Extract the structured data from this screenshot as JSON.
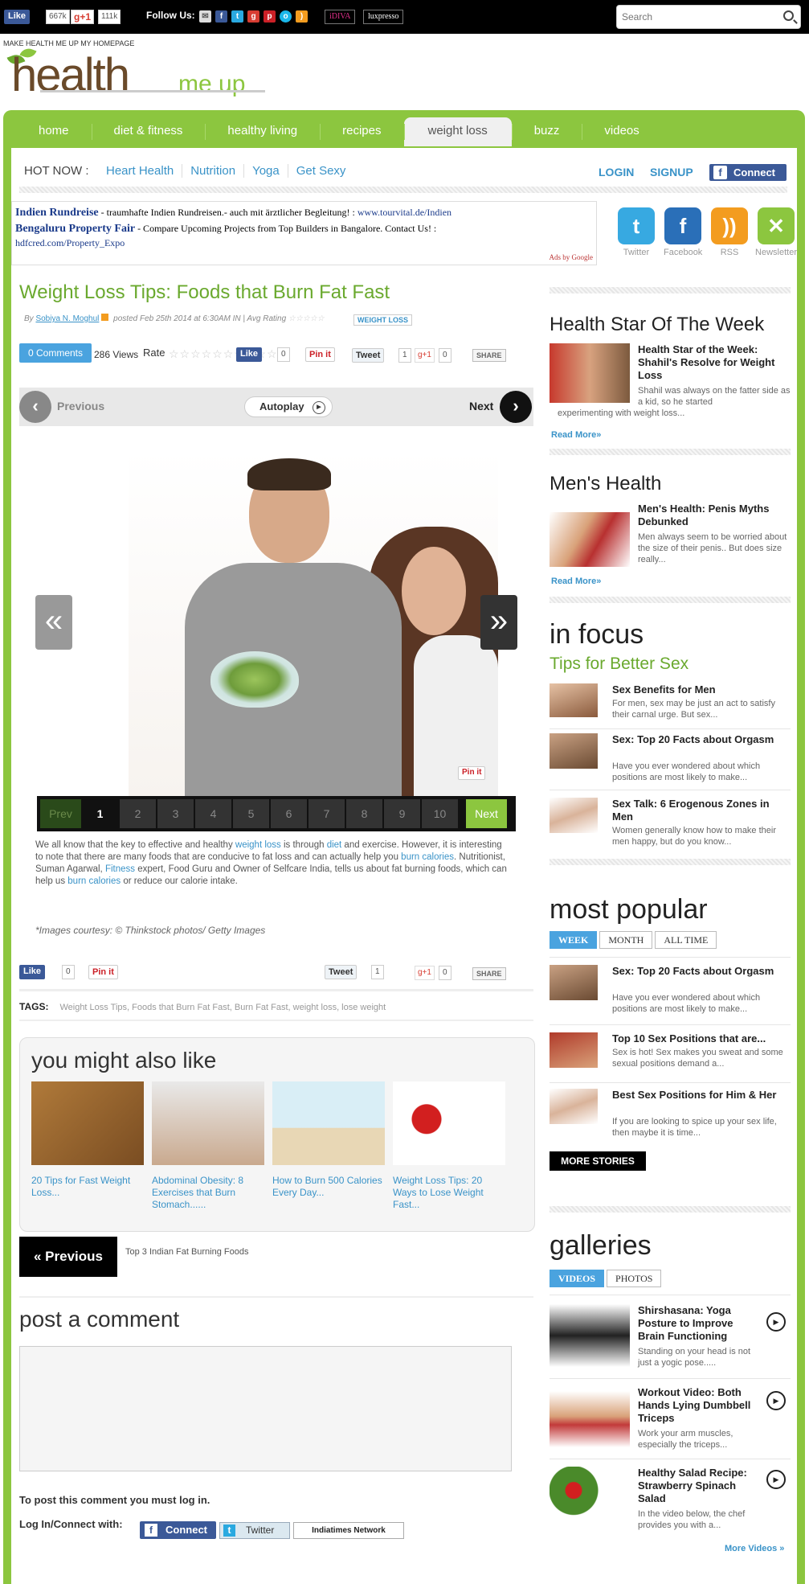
{
  "topbar": {
    "fb_like": "Like",
    "fb_count": "667k",
    "gplus": "g+1",
    "gplus_count": "111k",
    "follow_us": "Follow Us:",
    "brands": [
      "iDIVA",
      "luxpresso"
    ],
    "search_placeholder": "Search"
  },
  "header": {
    "make_homepage": "MAKE HEALTH ME UP MY HOMEPAGE",
    "logo_main": "health",
    "logo_sub": "me up"
  },
  "nav": {
    "items": [
      "home",
      "diet & fitness",
      "healthy living",
      "recipes",
      "weight loss",
      "buzz",
      "videos"
    ],
    "active_index": 4
  },
  "hotnow": {
    "label": "HOT NOW :",
    "links": [
      "Heart Health",
      "Nutrition",
      "Yoga",
      "Get Sexy"
    ],
    "login": "LOGIN",
    "signup": "SIGNUP",
    "connect": "Connect"
  },
  "ads": {
    "ad1_title": "Indien Rundreise",
    "ad1_text": " - traumhafte Indien Rundreisen.- auch mit ärztlicher Begleitung! : ",
    "ad1_url": "www.tourvital.de/Indien",
    "ad2_title": "Bengaluru Property Fair",
    "ad2_text": " - Compare Upcoming Projects from Top Builders in Bangalore. Contact Us! :",
    "ad2_url": "hdfcred.com/Property_Expo",
    "ads_by": "Ads by Google"
  },
  "social": {
    "items": [
      {
        "label": "Twitter",
        "glyph": "t",
        "color": "#37a9e1"
      },
      {
        "label": "Facebook",
        "glyph": "f",
        "color": "#2a6fb8"
      },
      {
        "label": "RSS",
        "glyph": "))",
        "color": "#f39c1f"
      },
      {
        "label": "Newsletter",
        "glyph": "✕",
        "color": "#8cc63f"
      }
    ]
  },
  "article": {
    "title": "Weight Loss Tips: Foods that Burn Fat Fast",
    "by": "By ",
    "author": "Sobiya N. Moghul",
    "posted": " posted Feb 25th 2014 at 6:30AM IN | Avg Rating ",
    "tag": "WEIGHT LOSS",
    "comments": "0 Comments",
    "views": "286 Views",
    "rate": "Rate",
    "like": "Like",
    "like_count": "0",
    "pinit": "Pin it",
    "tweet": "Tweet",
    "tweet_count": "1",
    "gplus": "g+1",
    "gplus_count": "0",
    "share": "SHARE",
    "prev": "Previous",
    "next": "Next",
    "autoplay": "Autoplay",
    "pager": [
      "Prev",
      "1",
      "2",
      "3",
      "4",
      "5",
      "6",
      "7",
      "8",
      "9",
      "10",
      "Next"
    ],
    "current_page": 1,
    "lead_1": "We all know that the key to effective and healthy ",
    "lead_link1": "weight loss",
    "lead_2": " is through ",
    "lead_link2": "diet",
    "lead_3": " and exercise. However, it is interesting to note that there are many foods that are conducive to fat loss and can actually help you ",
    "lead_link3": "burn calories",
    "lead_4": ". Nutritionist, Suman Agarwal, ",
    "lead_link4": "Fitness",
    "lead_5": " expert, Food Guru and Owner of Selfcare India, tells us about fat burning foods, which can help us ",
    "lead_link5": "burn calories",
    "lead_6": " or reduce our calorie intake.",
    "courtesy": "*Images courtesy: © Thinkstock photos/ Getty Images",
    "tags_label": "TAGS:",
    "tags": "Weight Loss Tips, Foods that Burn Fat Fast, Burn Fat Fast, weight loss, lose weight"
  },
  "you_might": {
    "heading": "you might also like",
    "items": [
      "20 Tips for Fast Weight Loss...",
      "Abdominal Obesity: 8 Exercises that Burn Stomach......",
      "How to Burn 500 Calories Every Day...",
      "Weight Loss Tips: 20 Ways to Lose Weight Fast..."
    ]
  },
  "prevpost": {
    "label": "« Previous",
    "title": "Top 3 Indian Fat Burning Foods"
  },
  "comment": {
    "heading": "post a comment",
    "must_login": "To post this comment you must log in.",
    "login_with": "Log In/Connect with:",
    "connect": "Connect",
    "twitter": "Twitter",
    "indiatimes": "Indiatimes Network"
  },
  "sidebar": {
    "star": {
      "heading": "Health Star Of The Week",
      "title": "Health Star of the Week: Shahil's Resolve for Weight Loss",
      "desc_a": "Shahil was always on the fatter side as a kid, so he started",
      "desc_b": "experimenting with weight loss...",
      "readmore": "Read More»"
    },
    "mens": {
      "heading": "Men's Health",
      "title": "Men's Health: Penis Myths Debunked",
      "desc": "Men always seem to be worried about the size of their penis.. But does size really...",
      "readmore": "Read More»"
    },
    "focus": {
      "heading": "in focus",
      "sub": "Tips for Better Sex",
      "items": [
        {
          "title": "Sex Benefits for Men",
          "desc": "For men, sex may be just an act to satisfy their carnal urge. But sex..."
        },
        {
          "title": "Sex: Top 20 Facts about Orgasm",
          "desc": "Have you ever wondered about which positions are most likely to make..."
        },
        {
          "title": "Sex Talk: 6 Erogenous Zones in Men",
          "desc": "Women generally know how to make their men happy, but do you know..."
        }
      ]
    },
    "popular": {
      "heading": "most popular",
      "tabs": [
        "WEEK",
        "MONTH",
        "ALL TIME"
      ],
      "items": [
        {
          "title": "Sex: Top 20 Facts about Orgasm",
          "desc": "Have you ever wondered about which positions are most likely to make..."
        },
        {
          "title": "Top 10 Sex Positions that are...",
          "desc": "Sex is hot! Sex makes you sweat and some sexual positions demand a..."
        },
        {
          "title": "Best Sex Positions for Him & Her",
          "desc": "If you are looking to spice up your sex life, then maybe it is time..."
        }
      ],
      "more": "MORE STORIES"
    },
    "galleries": {
      "heading": "galleries",
      "tabs": [
        "VIDEOS",
        "PHOTOS"
      ],
      "items": [
        {
          "title": "Shirshasana: Yoga Posture to Improve Brain Functioning",
          "desc": "Standing on your head is not just a yogic pose....."
        },
        {
          "title": "Workout Video: Both Hands Lying Dumbbell Triceps",
          "desc": "Work your arm muscles, especially the triceps..."
        },
        {
          "title": "Healthy Salad Recipe: Strawberry Spinach Salad",
          "desc": "In the video below, the chef provides you with a..."
        }
      ],
      "more": "More Videos »"
    }
  }
}
